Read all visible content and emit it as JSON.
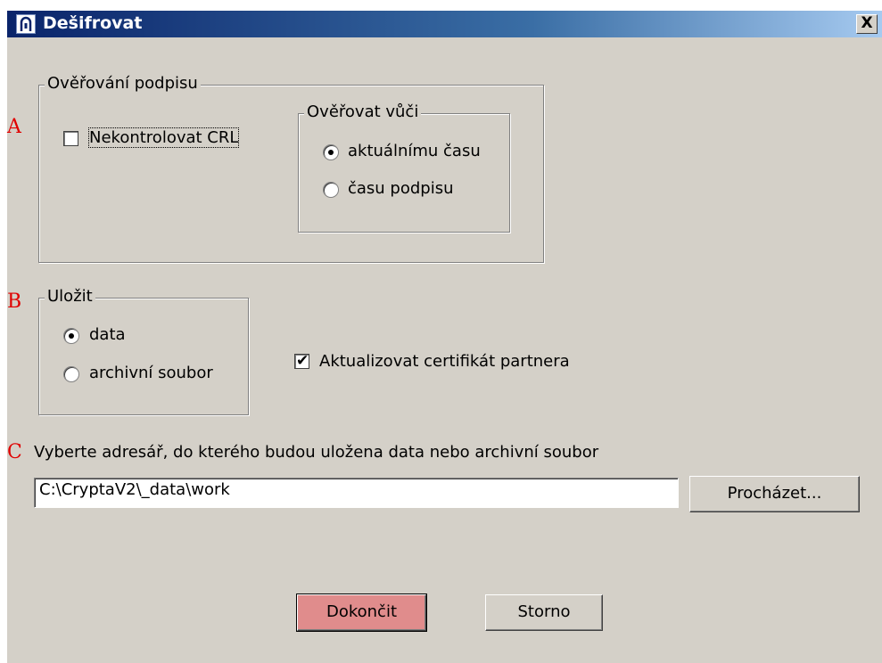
{
  "window": {
    "title": "Dešifrovat",
    "close_label": "X"
  },
  "markers": {
    "a": "A",
    "b": "B",
    "c": "C"
  },
  "signature_group": {
    "legend": "Ověřování podpisu",
    "no_crl_label": "Nekontrolovat CRL",
    "no_crl_checked": false,
    "verify_against": {
      "legend": "Ověřovat vůči",
      "options": [
        "aktuálnímu času",
        "času podpisu"
      ],
      "selected": "aktuálnímu času"
    }
  },
  "save_group": {
    "legend": "Uložit",
    "options": [
      "data",
      "archivní soubor"
    ],
    "selected": "data"
  },
  "update_partner_cert": {
    "label": "Aktualizovat certifikát partnera",
    "checked": true
  },
  "directory": {
    "prompt": "Vyberte adresář, do kterého budou uložena data nebo archivní soubor",
    "value": "C:\\CryptaV2\\_data\\work",
    "browse_label": "Procházet..."
  },
  "buttons": {
    "finish_label": "Dokončit",
    "cancel_label": "Storno"
  },
  "colors": {
    "window_bg": "#d4d0c8",
    "title_gradient_start": "#0a246a",
    "title_gradient_end": "#a6caf0",
    "default_button": "#e08c8c",
    "marker": "#e00000"
  }
}
